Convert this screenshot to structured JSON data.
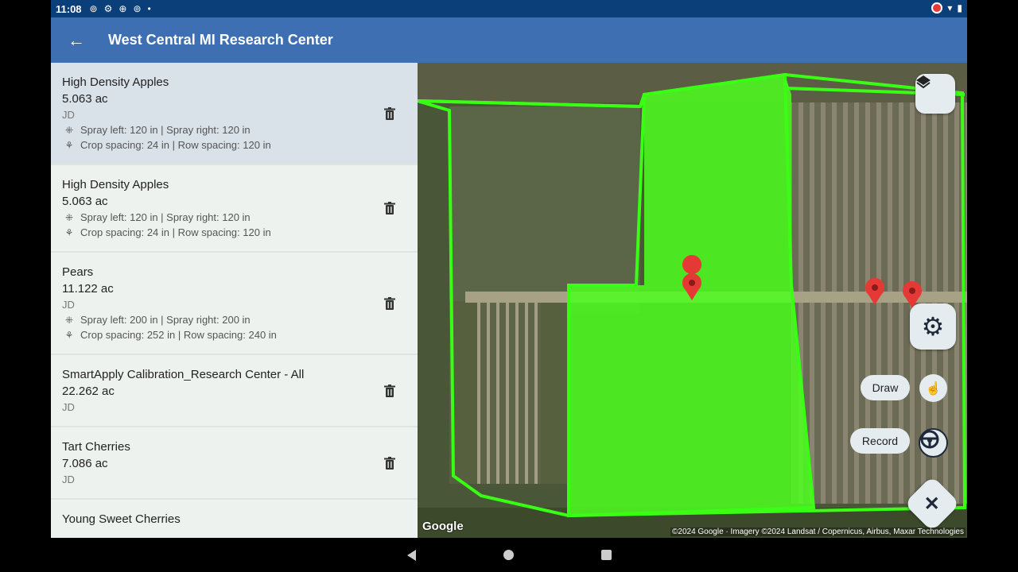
{
  "status_bar": {
    "time": "11:08",
    "icons": [
      "hotspot-icon",
      "gear-icon",
      "vpn-icon",
      "hotspot-icon",
      "dot-icon"
    ],
    "right_icons": [
      "record-indicator-icon",
      "wifi-icon",
      "battery-icon"
    ]
  },
  "app_bar": {
    "title": "West Central MI Research Center",
    "back_icon": "arrow-left-icon"
  },
  "fields": [
    {
      "name": "High Density Apples",
      "area": "5.063 ac",
      "operator": "JD",
      "spray": "Spray left: 120 in | Spray right: 120 in",
      "spacing": "Crop spacing: 24 in | Row spacing: 120 in",
      "selected": true
    },
    {
      "name": "High Density Apples",
      "area": "5.063 ac",
      "operator": "",
      "spray": "Spray left: 120 in | Spray right: 120 in",
      "spacing": "Crop spacing: 24 in | Row spacing: 120 in",
      "selected": false
    },
    {
      "name": "Pears",
      "area": "11.122 ac",
      "operator": "JD",
      "spray": "Spray left: 200 in | Spray right: 200 in",
      "spacing": "Crop spacing: 252 in | Row spacing: 240 in",
      "selected": false
    },
    {
      "name": "SmartApply Calibration_Research Center - All",
      "area": "22.262 ac",
      "operator": "JD",
      "spray": "",
      "spacing": "",
      "selected": false
    },
    {
      "name": "Tart Cherries",
      "area": "7.086 ac",
      "operator": "JD",
      "spray": "",
      "spacing": "",
      "selected": false
    },
    {
      "name": "Young Sweet Cherries",
      "area": "",
      "operator": "",
      "spray": "",
      "spacing": "",
      "selected": false
    }
  ],
  "map": {
    "google_logo": "Google",
    "attribution": "©2024 Google · Imagery ©2024 Landsat / Copernicus, Airbus, Maxar Technologies",
    "highlight_color": "#39ff14",
    "marker_color": "#e53935",
    "draw_label": "Draw",
    "record_label": "Record",
    "layers_icon": "layers-icon",
    "settings_icon": "gear-icon",
    "draw_icon": "touch-hand-icon",
    "record_icon": "steering-wheel-icon",
    "close_icon": "close-icon"
  },
  "nav_bar": {
    "icons": [
      "back-triangle-icon",
      "home-circle-icon",
      "recents-square-icon"
    ]
  }
}
